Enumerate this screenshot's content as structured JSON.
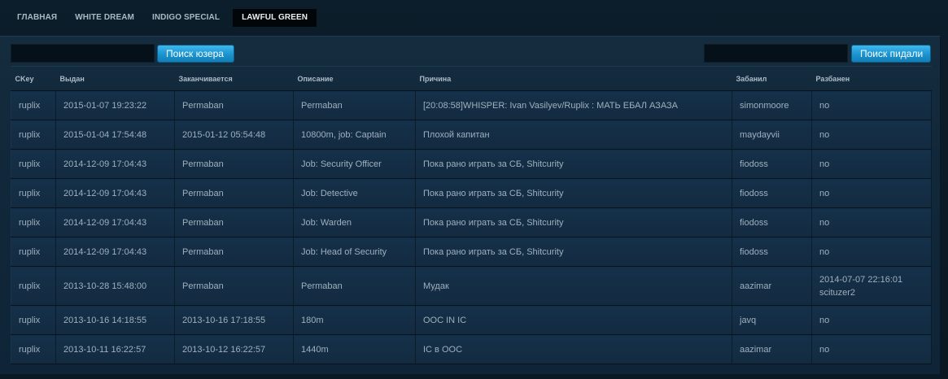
{
  "nav": {
    "items": [
      {
        "label": "ГЛАВНАЯ",
        "active": false
      },
      {
        "label": "WHITE DREAM",
        "active": false
      },
      {
        "label": "INDIGO SPECIAL",
        "active": false
      },
      {
        "label": "LAWFUL GREEN",
        "active": true
      }
    ]
  },
  "toolbar": {
    "user_search": {
      "value": "",
      "button_label": "Поиск юзера"
    },
    "admin_search": {
      "value": "",
      "button_label": "Поиск пидали"
    }
  },
  "table": {
    "columns": [
      "CKey",
      "Выдан",
      "Заканчивается",
      "Описание",
      "Причина",
      "Забанил",
      "Разбанен"
    ],
    "rows": [
      {
        "ckey": "ruplix",
        "issued": "2015-01-07 19:23:22",
        "expires": "Permaban",
        "description": "Permaban",
        "reason": "[20:08:58]WHISPER: Ivan Vasilyev/Ruplix : МАТЬ ЕБАЛ АЗАЗА",
        "banned_by": "simonmoore",
        "unbanned": "no"
      },
      {
        "ckey": "ruplix",
        "issued": "2015-01-04 17:54:48",
        "expires": "2015-01-12 05:54:48",
        "description": "10800m, job: Captain",
        "reason": "Плохой капитан",
        "banned_by": "maydayvii",
        "unbanned": "no"
      },
      {
        "ckey": "ruplix",
        "issued": "2014-12-09 17:04:43",
        "expires": "Permaban",
        "description": "Job: Security Officer",
        "reason": "Пока рано играть за СБ, Shitcurity",
        "banned_by": "fiodoss",
        "unbanned": "no"
      },
      {
        "ckey": "ruplix",
        "issued": "2014-12-09 17:04:43",
        "expires": "Permaban",
        "description": "Job: Detective",
        "reason": "Пока рано играть за СБ, Shitcurity",
        "banned_by": "fiodoss",
        "unbanned": "no"
      },
      {
        "ckey": "ruplix",
        "issued": "2014-12-09 17:04:43",
        "expires": "Permaban",
        "description": "Job: Warden",
        "reason": "Пока рано играть за СБ, Shitcurity",
        "banned_by": "fiodoss",
        "unbanned": "no"
      },
      {
        "ckey": "ruplix",
        "issued": "2014-12-09 17:04:43",
        "expires": "Permaban",
        "description": "Job: Head of Security",
        "reason": "Пока рано играть за СБ, Shitcurity",
        "banned_by": "fiodoss",
        "unbanned": "no"
      },
      {
        "ckey": "ruplix",
        "issued": "2013-10-28 15:48:00",
        "expires": "Permaban",
        "description": "Permaban",
        "reason": "Мудак",
        "banned_by": "aazimar",
        "unbanned": "2014-07-07 22:16:01 scituzer2"
      },
      {
        "ckey": "ruplix",
        "issued": "2013-10-16 14:18:55",
        "expires": "2013-10-16 17:18:55",
        "description": "180m",
        "reason": "OOC IN IC",
        "banned_by": "javq",
        "unbanned": "no"
      },
      {
        "ckey": "ruplix",
        "issued": "2013-10-11 16:22:57",
        "expires": "2013-10-12 16:22:57",
        "description": "1440m",
        "reason": "IC в OOC",
        "banned_by": "aazimar",
        "unbanned": "no"
      }
    ]
  }
}
